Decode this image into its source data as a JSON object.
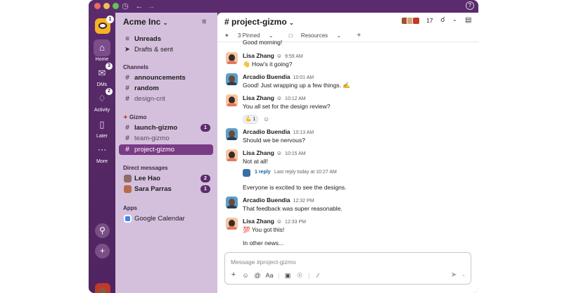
{
  "titlebar": {
    "history_icon": "clock-icon",
    "back_icon": "arrow-left-icon",
    "forward_icon": "arrow-right-icon",
    "help_label": "?"
  },
  "rail": {
    "workspace_badge": "1",
    "items": [
      {
        "label": "Home",
        "icon": "home-icon"
      },
      {
        "label": "DMs",
        "icon": "dms-icon",
        "badge": "3"
      },
      {
        "label": "Activity",
        "icon": "bell-icon",
        "badge": "2"
      },
      {
        "label": "Later",
        "icon": "bookmark-icon"
      },
      {
        "label": "More",
        "icon": "ellipsis-icon"
      }
    ]
  },
  "sidebar": {
    "workspace": "Acme Inc",
    "top_items": [
      {
        "label": "Unreads",
        "icon": "unreads-icon"
      },
      {
        "label": "Drafts & sent",
        "icon": "send-icon"
      }
    ],
    "channels_header": "Channels",
    "channels": [
      {
        "label": "announcements"
      },
      {
        "label": "random"
      },
      {
        "label": "design-crit"
      }
    ],
    "gizmo_header": "Gizmo",
    "gizmo_channels": [
      {
        "label": "launch-gizmo",
        "count": "1"
      },
      {
        "label": "team-gizmo"
      },
      {
        "label": "project-gizmo"
      }
    ],
    "dm_header": "Direct messages",
    "dms": [
      {
        "label": "Lee Hao",
        "count": "2"
      },
      {
        "label": "Sara Parras",
        "count": "1"
      }
    ],
    "apps_header": "Apps",
    "apps": [
      {
        "label": "Google Calendar"
      }
    ]
  },
  "channel": {
    "title": "# project-gizmo",
    "member_count": "17",
    "pinned": "3 Pinned",
    "resources": "Resources"
  },
  "messages": [
    {
      "text": "Good morning!"
    },
    {
      "name": "Lisa Zhang",
      "time": "9:59 AM",
      "text": "👋 How's it going?"
    },
    {
      "name": "Arcadio Buendia",
      "time": "10:01 AM",
      "text": "Good! Just wrapping up a few things. ✍"
    },
    {
      "name": "Lisa Zhang",
      "time": "10:12 AM",
      "text": "You all set for the design review?"
    },
    {
      "name": "Arcadio Buendia",
      "time": "10:13 AM",
      "text": "Should we be nervous?"
    },
    {
      "name": "Lisa Zhang",
      "time": "10:15 AM",
      "text": "Not at all!"
    },
    {
      "text": "Everyone is excited to see the designs."
    },
    {
      "name": "Arcadio Buendia",
      "time": "12:32 PM",
      "text": "That feedback was super reasonable."
    },
    {
      "name": "Lisa Zhang",
      "time": "12:33 PM",
      "text": "💯 You got this!"
    },
    {
      "text": "In other news..."
    }
  ],
  "reaction": {
    "emoji": "💪",
    "count": "1"
  },
  "thread": {
    "replies": "1 reply",
    "last": "Last reply today at 10:27 AM"
  },
  "composer": {
    "placeholder": "Message #project-gizmo",
    "format_label": "Aa"
  }
}
